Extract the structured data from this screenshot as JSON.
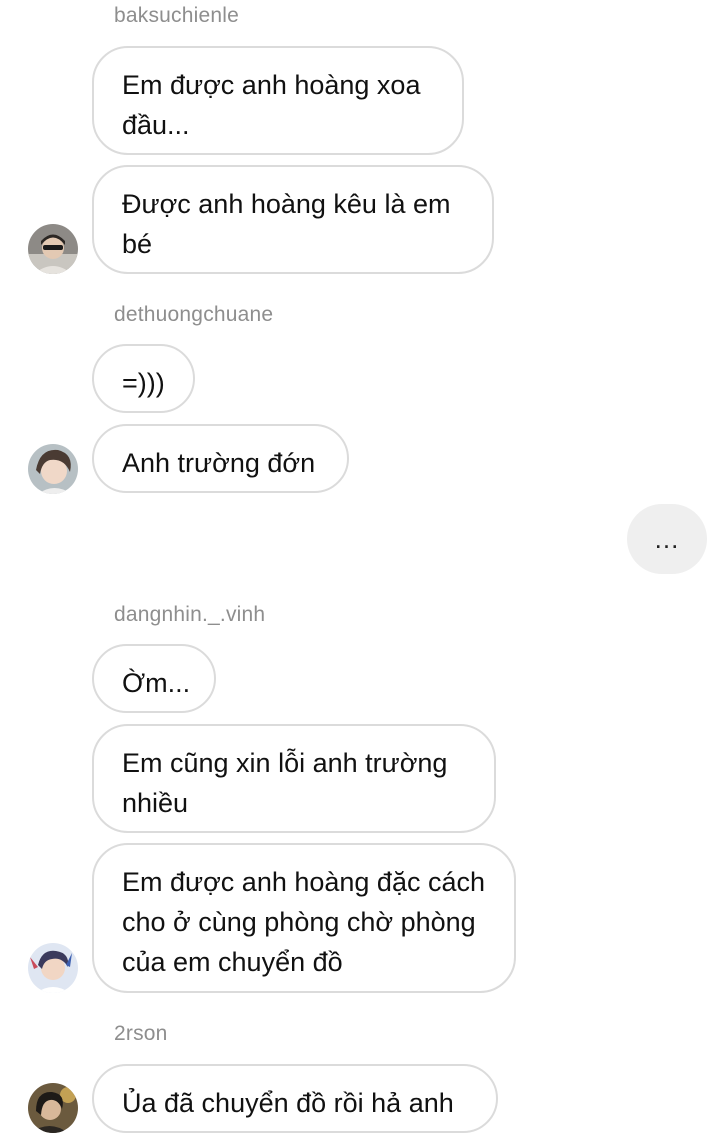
{
  "groups": [
    {
      "username": "baksuchienle",
      "messages": [
        "Em được anh hoàng xoa đầu...",
        "Được anh hoàng kêu là em bé"
      ]
    },
    {
      "username": "dethuongchuane",
      "messages": [
        "=)))",
        "Anh trường đớn"
      ]
    },
    {
      "username": "dangnhin._.vinh",
      "messages": [
        "Ờm...",
        "Em cũng xin lỗi anh trường nhiều",
        "Em được anh hoàng đặc cách cho ở cùng phòng chờ phòng của em chuyển đồ"
      ]
    },
    {
      "username": "2rson",
      "messages": [
        "Ủa đã chuyển đồ rồi hả anh"
      ]
    }
  ],
  "typing_indicator": "...",
  "avatars": [
    "avatar-baksuchienle",
    "avatar-dethuongchuane",
    "avatar-dangnhin-vinh",
    "avatar-2rson"
  ]
}
